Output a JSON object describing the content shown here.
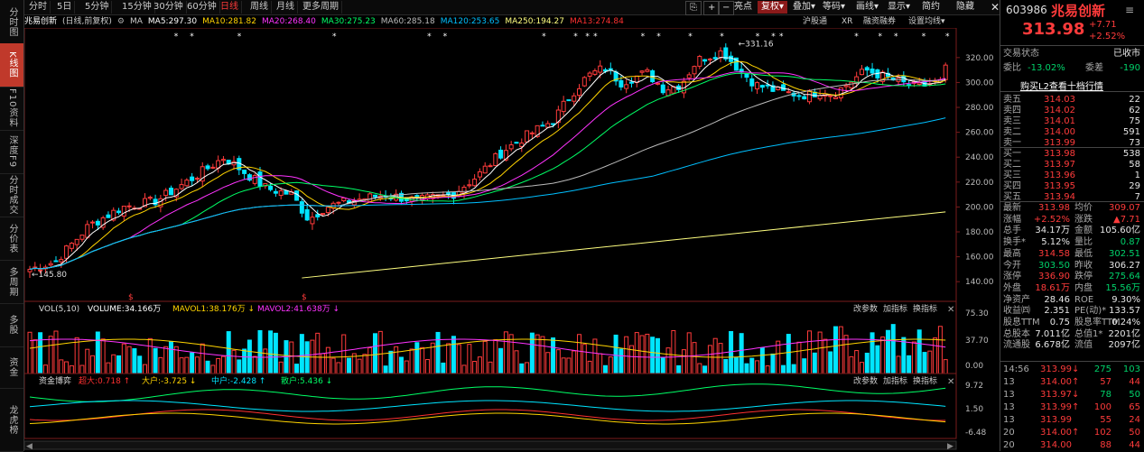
{
  "left_tabs": [
    "分时图",
    "K线图",
    "F10资料",
    "深度F9",
    "分时成交",
    "分价表",
    "多周期",
    "多股",
    "资金",
    "龙虎榜"
  ],
  "period_bar": {
    "periods": [
      "分时",
      "5日",
      "5分钟",
      "15分钟",
      "30分钟",
      "60分钟",
      "日线",
      "周线",
      "月线",
      "更多周期"
    ],
    "active": "日线",
    "tools": [
      "亮点",
      "复权",
      "叠加",
      "等码",
      "画线",
      "显示",
      "简约",
      "隐藏"
    ]
  },
  "ma_bar": {
    "stock": "兆易创新",
    "mode": "(日线,前复权)",
    "label": "MA",
    "items": [
      {
        "t": "MA5:297.30",
        "c": "#ffffff"
      },
      {
        "t": "MA10:281.82",
        "c": "#ffd400"
      },
      {
        "t": "MA20:268.40",
        "c": "#ff33ff"
      },
      {
        "t": "MA30:275.23",
        "c": "#00ff66"
      },
      {
        "t": "MA60:285.18",
        "c": "#bbbbbb"
      },
      {
        "t": "MA120:253.65",
        "c": "#00bfff"
      },
      {
        "t": "MA250:194.27",
        "c": "#ffff80"
      },
      {
        "t": "MA13:274.84",
        "c": "#ff3030"
      }
    ],
    "right_tabs": [
      "沪股通",
      "XR",
      "融资融券",
      "设置均线"
    ]
  },
  "price_axis": [
    "320.00",
    "300.00",
    "280.00",
    "260.00",
    "240.00",
    "220.00",
    "200.00",
    "180.00",
    "160.00",
    "140.00"
  ],
  "annotations": {
    "high": "331.16",
    "low": "145.80"
  },
  "vol_bar": {
    "title": "VOL(5,10)",
    "items": [
      {
        "t": "VOLUME:34.166万",
        "c": "#ffffff"
      },
      {
        "t": "MAVOL1:38.176万",
        "c": "#ffd400"
      },
      {
        "t": "MAVOL2:41.638万",
        "c": "#ff33ff"
      }
    ],
    "right": [
      "改参数",
      "加指标",
      "换指标"
    ],
    "axis": [
      "75.30",
      "37.70",
      "0.00"
    ]
  },
  "fund_bar": {
    "title": "资金博弈",
    "items": [
      {
        "t": "超大:0.718",
        "c": "#ff3030"
      },
      {
        "t": "大户:-3.725",
        "c": "#ffd400"
      },
      {
        "t": "中户:-2.428",
        "c": "#00e5ff"
      },
      {
        "t": "散户:5.436",
        "c": "#00ff66"
      }
    ],
    "right": [
      "改参数",
      "加指标",
      "换指标"
    ],
    "axis": [
      "9.72",
      "1.50",
      "-6.48"
    ]
  },
  "time_axis": [
    "10",
    "11",
    "12",
    "2026",
    "02",
    "03",
    "04"
  ],
  "quote": {
    "code": "603986",
    "name": "兆易创新",
    "price": "313.98",
    "change": "+7.71",
    "pct": "+2.52%",
    "status_label": "交易状态",
    "status": "已收市",
    "wb_label": "委比",
    "wb": "-13.02%",
    "wc_label": "委差",
    "wc": "-190",
    "l2": "购买L2查看十档行情",
    "asks": [
      {
        "n": "卖五",
        "p": "314.03",
        "v": "22"
      },
      {
        "n": "卖四",
        "p": "314.02",
        "v": "62"
      },
      {
        "n": "卖三",
        "p": "314.01",
        "v": "75"
      },
      {
        "n": "卖二",
        "p": "314.00",
        "v": "591"
      },
      {
        "n": "卖一",
        "p": "313.99",
        "v": "73"
      }
    ],
    "bids": [
      {
        "n": "买一",
        "p": "313.98",
        "v": "538"
      },
      {
        "n": "买二",
        "p": "313.97",
        "v": "58"
      },
      {
        "n": "买三",
        "p": "313.96",
        "v": "1"
      },
      {
        "n": "买四",
        "p": "313.95",
        "v": "29"
      },
      {
        "n": "买五",
        "p": "313.94",
        "v": "7"
      }
    ],
    "stats": [
      {
        "a": "最新",
        "b": "313.98",
        "bc": "red",
        "c": "均价",
        "d": "309.07",
        "dc": "red"
      },
      {
        "a": "涨幅",
        "b": "+2.52%",
        "bc": "red",
        "c": "涨跌",
        "d": "▲7.71",
        "dc": "red"
      },
      {
        "a": "总手",
        "b": "34.17万",
        "bc": "white",
        "c": "金额",
        "d": "105.60亿",
        "dc": "white"
      },
      {
        "a": "换手*",
        "b": "5.12%",
        "bc": "white",
        "c": "量比",
        "d": "0.87",
        "dc": "green"
      },
      {
        "a": "最高",
        "b": "314.58",
        "bc": "red",
        "c": "最低",
        "d": "302.51",
        "dc": "green"
      },
      {
        "a": "今开",
        "b": "303.50",
        "bc": "green",
        "c": "昨收",
        "d": "306.27",
        "dc": "white"
      },
      {
        "a": "涨停",
        "b": "336.90",
        "bc": "red",
        "c": "跌停",
        "d": "275.64",
        "dc": "green"
      },
      {
        "a": "外盘",
        "b": "18.61万",
        "bc": "red",
        "c": "内盘",
        "d": "15.56万",
        "dc": "green"
      },
      {
        "a": "净资产",
        "b": "28.46",
        "bc": "white",
        "c": "ROE",
        "d": "9.30%",
        "dc": "white"
      },
      {
        "a": "收益㈣",
        "b": "2.351",
        "bc": "white",
        "c": "PE(动)*",
        "d": "133.57",
        "dc": "white"
      },
      {
        "a": "股息TTM",
        "b": "0.75",
        "bc": "white",
        "c": "股息率TTM",
        "d": "0.24%",
        "dc": "white"
      },
      {
        "a": "总股本",
        "b": "7.011亿",
        "bc": "white",
        "c": "总值1*",
        "d": "2201亿",
        "dc": "white"
      },
      {
        "a": "流通股",
        "b": "6.678亿",
        "bc": "white",
        "c": "流值",
        "d": "2097亿",
        "dc": "white"
      }
    ],
    "ticks": [
      {
        "t": "14:56",
        "p": "313.99",
        "a": "↓",
        "v": "275",
        "n": "103",
        "pc": "red",
        "vc": "green"
      },
      {
        "t": "13",
        "p": "314.00",
        "a": "↑",
        "v": "57",
        "n": "44",
        "pc": "red",
        "vc": "red"
      },
      {
        "t": "13",
        "p": "313.97",
        "a": "↓",
        "v": "78",
        "n": "50",
        "pc": "red",
        "vc": "green"
      },
      {
        "t": "13",
        "p": "313.99",
        "a": "↑",
        "v": "100",
        "n": "65",
        "pc": "red",
        "vc": "red"
      },
      {
        "t": "13",
        "p": "313.99",
        "a": "",
        "v": "55",
        "n": "24",
        "pc": "red",
        "vc": "red"
      },
      {
        "t": "20",
        "p": "314.00",
        "a": "↑",
        "v": "102",
        "n": "50",
        "pc": "red",
        "vc": "red"
      },
      {
        "t": "20",
        "p": "314.00",
        "a": "",
        "v": "88",
        "n": "44",
        "pc": "red",
        "vc": "red"
      }
    ]
  }
}
